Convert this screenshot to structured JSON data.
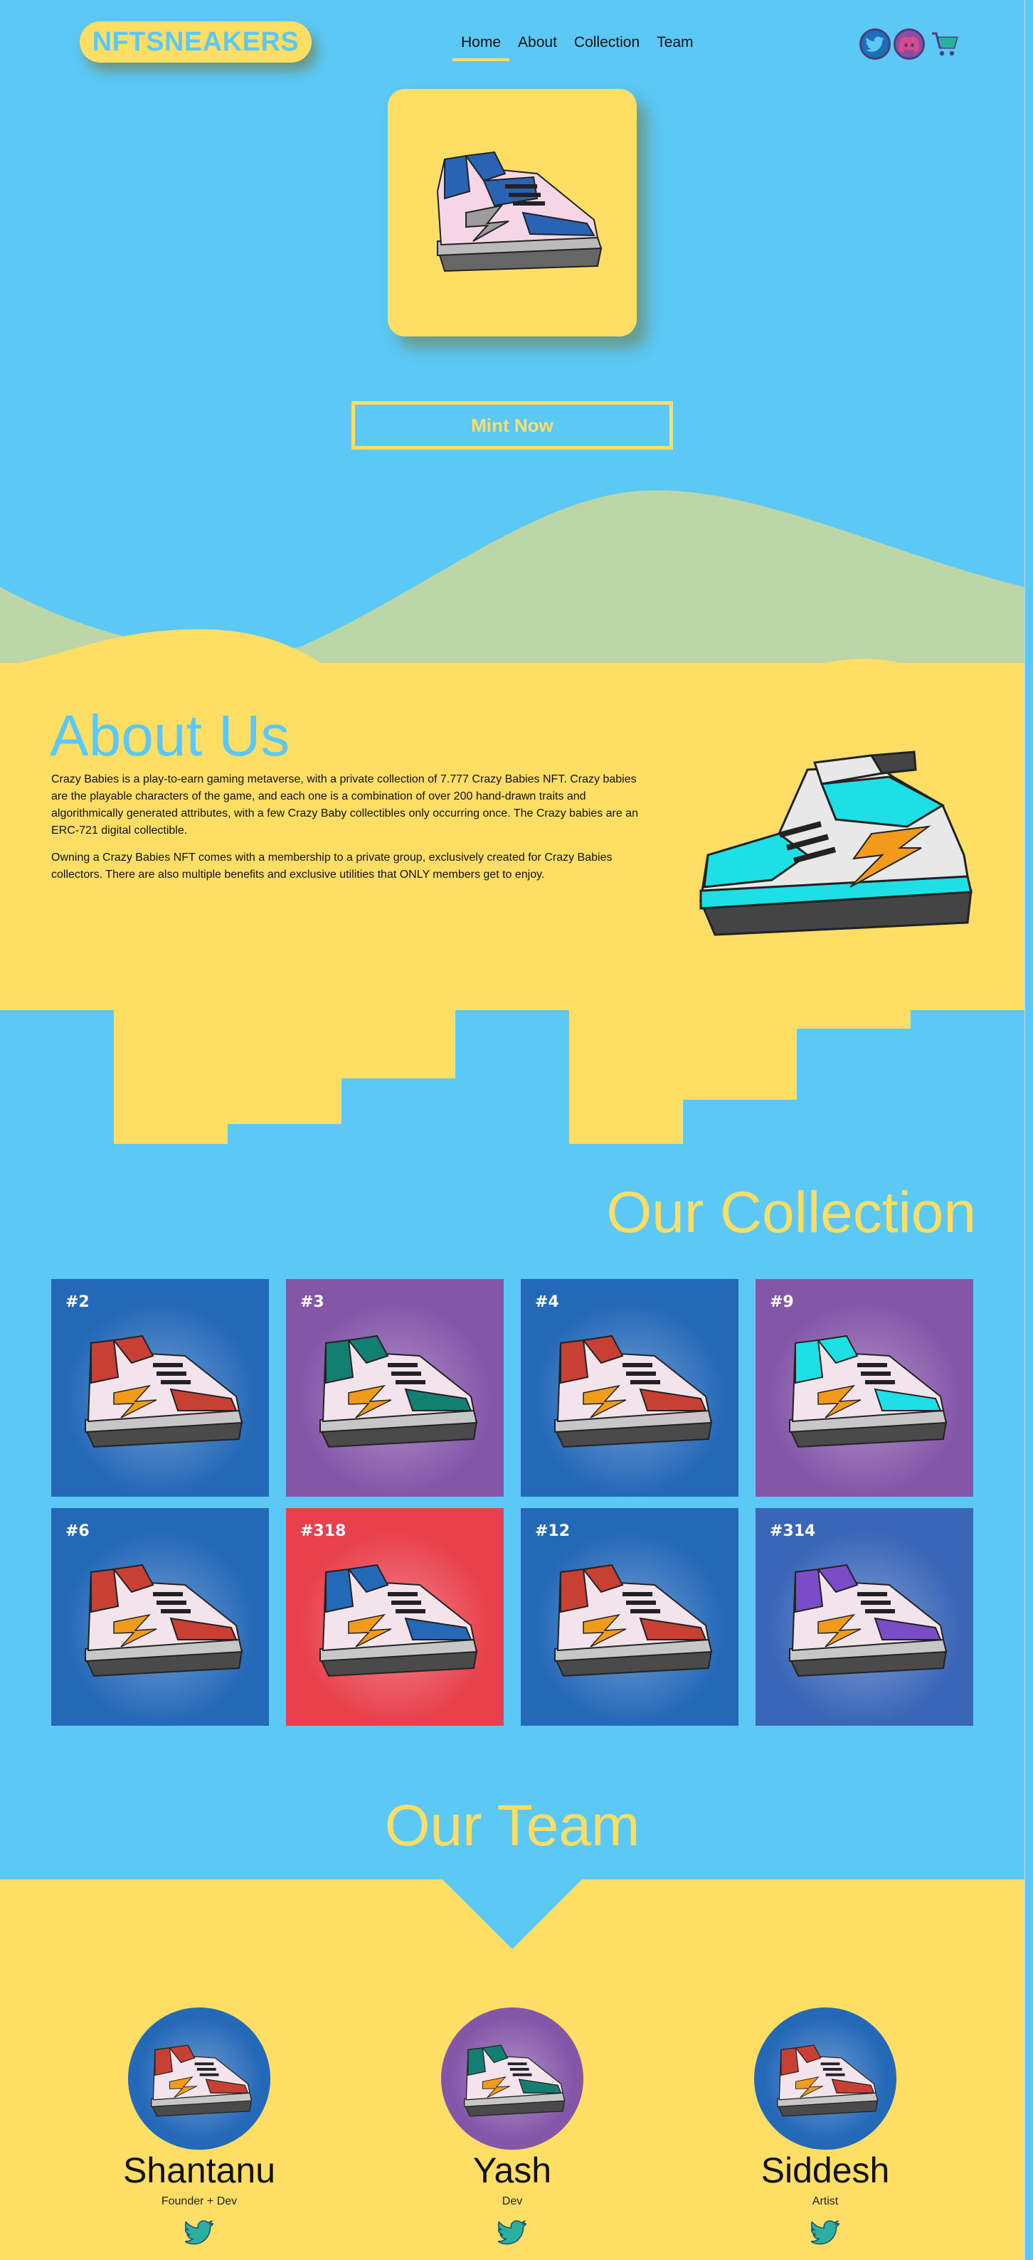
{
  "brand": {
    "logo_text": "NFTSNEAKERS"
  },
  "nav": {
    "items": [
      {
        "label": "Home",
        "active": true
      },
      {
        "label": "About",
        "active": false
      },
      {
        "label": "Collection",
        "active": false
      },
      {
        "label": "Team",
        "active": false
      }
    ]
  },
  "social": {
    "icons": [
      "twitter-icon",
      "discord-icon",
      "cart-icon"
    ]
  },
  "hero": {
    "mint_label": "Mint Now"
  },
  "about": {
    "title": "About Us",
    "p1": "Crazy Babies is a play-to-earn gaming metaverse, with a private collection of 7.777 Crazy Babies NFT. Crazy babies are the playable characters of the game, and each one is a combination of over 200 hand-drawn traits and algorithmically generated attributes, with a few Crazy Baby collectibles only occurring once. The Crazy babies are an ERC-721 digital collectible.",
    "p2": "Owning a Crazy Babies NFT comes with a membership to a private group, exclusively created for Crazy Babies collectors. There are also multiple benefits and exclusive utilities that ONLY members get to enjoy."
  },
  "collection": {
    "title": "Our Collection",
    "items": [
      {
        "id": "#2",
        "bg": "#2468b8",
        "accent": "#c84034"
      },
      {
        "id": "#3",
        "bg": "#8456a8",
        "accent": "#127f72"
      },
      {
        "id": "#4",
        "bg": "#2468b8",
        "accent": "#c84034"
      },
      {
        "id": "#9",
        "bg": "#8456a8",
        "accent": "#1ce0e6"
      },
      {
        "id": "#6",
        "bg": "#2468b8",
        "accent": "#c84034"
      },
      {
        "id": "#318",
        "bg": "#e8404c",
        "accent": "#2468b8"
      },
      {
        "id": "#12",
        "bg": "#2468b8",
        "accent": "#c84034"
      },
      {
        "id": "#314",
        "bg": "#3a66b8",
        "accent": "#7a4cc8"
      }
    ]
  },
  "team": {
    "title": "Our Team",
    "members": [
      {
        "name": "Shantanu",
        "role": "Founder + Dev",
        "bg": "#2468b8",
        "accent": "#c84034"
      },
      {
        "name": "Yash",
        "role": "Dev",
        "bg": "#8456a8",
        "accent": "#127f72"
      },
      {
        "name": "Siddesh",
        "role": "Artist",
        "bg": "#2468b8",
        "accent": "#c84034"
      }
    ]
  },
  "colors": {
    "sky": "#5bc8f5",
    "sand": "#ffde66",
    "hill": "#bcd6a8"
  }
}
